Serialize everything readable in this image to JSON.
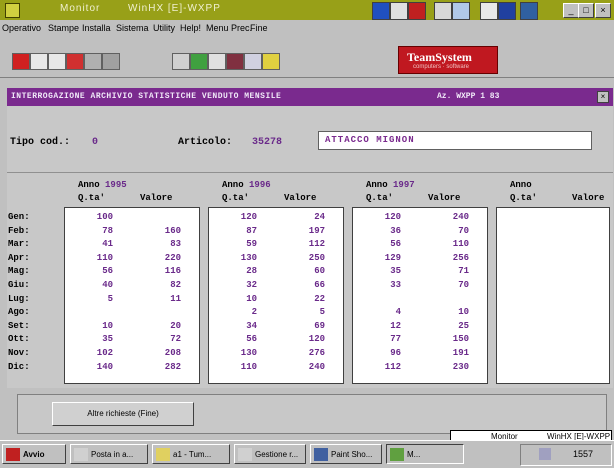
{
  "window": {
    "title": "Monitor",
    "subtitle": "WinHX [E]-WXPP"
  },
  "menu": [
    "Operativo",
    "Stampe",
    "Installa",
    "Sistema",
    "Utility",
    "Help!",
    "Menu Prec.",
    "Fine"
  ],
  "logo": {
    "text": "TeamSystem",
    "subtext": "computers · software"
  },
  "header": {
    "title": "INTERROGAZIONE ARCHIVIO STATISTICHE VENDUTO MENSILE",
    "company": "Az. WXPP 1 83"
  },
  "form": {
    "tipo_label": "Tipo cod.:",
    "tipo_value": "0",
    "articolo_label": "Articolo:",
    "articolo_value": "35278",
    "description": "ATTACCO MIGNON"
  },
  "columns": {
    "anno_label": "Anno",
    "qta_label": "Q.ta'",
    "valore_label": "Valore"
  },
  "months": [
    "Gen:",
    "Feb:",
    "Mar:",
    "Apr:",
    "Mag:",
    "Giu:",
    "Lug:",
    "Ago:",
    "Set:",
    "Ott:",
    "Nov:",
    "Dic:"
  ],
  "years": [
    {
      "year": "1995",
      "qta": [
        "100",
        "78",
        "41",
        "110",
        "56",
        "40",
        "5",
        "",
        "10",
        "35",
        "102",
        "140"
      ],
      "valore": [
        "",
        "160",
        "83",
        "220",
        "116",
        "82",
        "11",
        "",
        "20",
        "72",
        "208",
        "282"
      ]
    },
    {
      "year": "1996",
      "qta": [
        "120",
        "87",
        "59",
        "130",
        "28",
        "32",
        "10",
        "2",
        "34",
        "56",
        "130",
        "110"
      ],
      "valore": [
        "24",
        "197",
        "112",
        "250",
        "60",
        "66",
        "22",
        "5",
        "69",
        "120",
        "276",
        "240"
      ]
    },
    {
      "year": "1997",
      "qta": [
        "120",
        "36",
        "56",
        "129",
        "35",
        "33",
        "",
        "4",
        "12",
        "77",
        "96",
        "112"
      ],
      "valore": [
        "240",
        "70",
        "110",
        "256",
        "71",
        "70",
        "",
        "10",
        "25",
        "150",
        "191",
        "230"
      ]
    },
    {
      "year": "",
      "qta": [
        "",
        "",
        "",
        "",
        "",
        "",
        "",
        "",
        "",
        "",
        "",
        ""
      ],
      "valore": [
        "",
        "",
        "",
        "",
        "",
        "",
        "",
        "",
        "",
        "",
        "",
        ""
      ]
    }
  ],
  "button_label": "Altre richieste (Fine)",
  "taskbar": {
    "start": "Avvio",
    "items": [
      "Posta in a...",
      "a1 - Tum...",
      "Gestione r...",
      "Paint Sho...",
      "M..."
    ],
    "clock": "1557"
  },
  "tooltip": {
    "left": "Monitor",
    "right": "WinHX [E]-WXPP"
  },
  "colors": {
    "title": "#98a018",
    "band": "#7a2a8e",
    "value": "#6a2a8a",
    "logo": "#c01820"
  }
}
